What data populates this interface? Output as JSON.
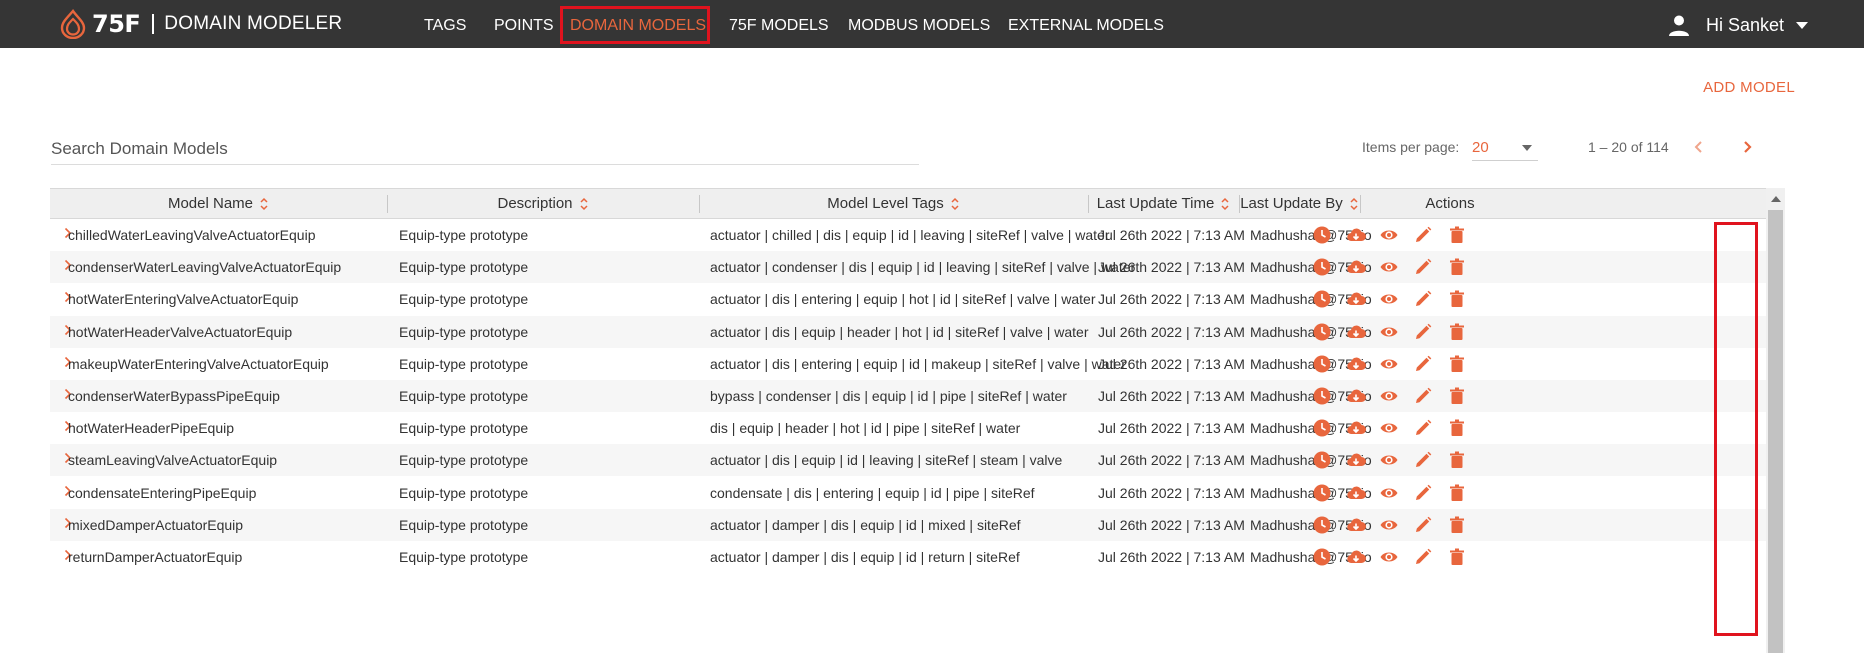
{
  "app": {
    "brand": "75F",
    "title": "DOMAIN MODELER"
  },
  "nav": {
    "items": [
      {
        "label": "TAGS",
        "active": false
      },
      {
        "label": "POINTS",
        "active": false
      },
      {
        "label": "DOMAIN MODELS",
        "active": true
      },
      {
        "label": "75F MODELS",
        "active": false
      },
      {
        "label": "MODBUS MODELS",
        "active": false
      },
      {
        "label": "EXTERNAL MODELS",
        "active": false
      }
    ]
  },
  "user": {
    "greeting": "Hi Sanket",
    "icon": "user-icon"
  },
  "actions": {
    "add_model": "ADD MODEL"
  },
  "search": {
    "placeholder": "Search Domain Models",
    "value": ""
  },
  "pager": {
    "items_label": "Items per page:",
    "items_per_page": "20",
    "range": "1 – 20 of 114"
  },
  "table": {
    "columns": [
      "Model Name",
      "Description",
      "Model Level Tags",
      "Last Update Time",
      "Last Update By",
      "Actions"
    ],
    "rows": [
      {
        "name": "chilledWaterLeavingValveActuatorEquip",
        "description": "Equip-type prototype",
        "tags": "actuator | chilled | dis | equip | id | leaving | siteRef | valve | water",
        "time": "Jul 26th 2022 | 7:13 AM",
        "by": "Madhushan@75f.io"
      },
      {
        "name": "condenserWaterLeavingValveActuatorEquip",
        "description": "Equip-type prototype",
        "tags": "actuator | condenser | dis | equip | id | leaving | siteRef | valve | water",
        "time": "Jul 26th 2022 | 7:13 AM",
        "by": "Madhushan@75f.io"
      },
      {
        "name": "hotWaterEnteringValveActuatorEquip",
        "description": "Equip-type prototype",
        "tags": "actuator | dis | entering | equip | hot | id | siteRef | valve | water",
        "time": "Jul 26th 2022 | 7:13 AM",
        "by": "Madhushan@75f.io"
      },
      {
        "name": "hotWaterHeaderValveActuatorEquip",
        "description": "Equip-type prototype",
        "tags": "actuator | dis | equip | header | hot | id | siteRef | valve | water",
        "time": "Jul 26th 2022 | 7:13 AM",
        "by": "Madhushan@75f.io"
      },
      {
        "name": "makeupWaterEnteringValveActuatorEquip",
        "description": "Equip-type prototype",
        "tags": "actuator | dis | entering | equip | id | makeup | siteRef | valve | water",
        "time": "Jul 26th 2022 | 7:13 AM",
        "by": "Madhushan@75f.io"
      },
      {
        "name": "condenserWaterBypassPipeEquip",
        "description": "Equip-type prototype",
        "tags": "bypass | condenser | dis | equip | id | pipe | siteRef | water",
        "time": "Jul 26th 2022 | 7:13 AM",
        "by": "Madhushan@75f.io"
      },
      {
        "name": "hotWaterHeaderPipeEquip",
        "description": "Equip-type prototype",
        "tags": "dis | equip | header | hot | id | pipe | siteRef | water",
        "time": "Jul 26th 2022 | 7:13 AM",
        "by": "Madhushan@75f.io"
      },
      {
        "name": "steamLeavingValveActuatorEquip",
        "description": "Equip-type prototype",
        "tags": "actuator | dis | equip | id | leaving | siteRef | steam | valve",
        "time": "Jul 26th 2022 | 7:13 AM",
        "by": "Madhushan@75f.io"
      },
      {
        "name": "condensateEnteringPipeEquip",
        "description": "Equip-type prototype",
        "tags": "condensate | dis | entering | equip | id | pipe | siteRef",
        "time": "Jul 26th 2022 | 7:13 AM",
        "by": "Madhushan@75f.io"
      },
      {
        "name": "mixedDamperActuatorEquip",
        "description": "Equip-type prototype",
        "tags": "actuator | damper | dis | equip | id | mixed | siteRef",
        "time": "Jul 26th 2022 | 7:13 AM",
        "by": "Madhushan@75f.io"
      },
      {
        "name": "returnDamperActuatorEquip",
        "description": "Equip-type prototype",
        "tags": "actuator | damper | dis | equip | id | return | siteRef",
        "time": "Jul 26th 2022 | 7:13 AM",
        "by": "Madhushan@75f.io"
      }
    ],
    "row_actions": [
      "history-icon",
      "cloud-download-icon",
      "view-icon",
      "edit-icon",
      "delete-icon"
    ]
  },
  "colors": {
    "accent": "#e8663d",
    "topbar": "#353535",
    "highlight": "#e0131e"
  }
}
